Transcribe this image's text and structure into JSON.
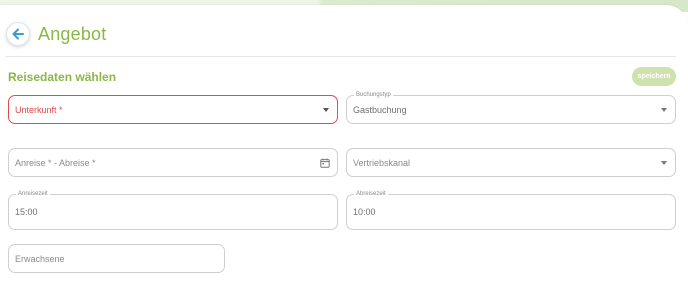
{
  "header": {
    "title": "Angebot",
    "back_icon": "arrow-left-icon"
  },
  "section": {
    "title": "Reisedaten wählen",
    "save_label": "speichern"
  },
  "fields": {
    "unterkunft": {
      "placeholder": "Unterkunft *"
    },
    "buchungstyp": {
      "label": "Buchungstyp",
      "value": "Gastbuchung"
    },
    "anreise_abreise": {
      "placeholder": "Anreise * - Abreise *"
    },
    "vertriebskanal": {
      "placeholder": "Vertriebskanal"
    },
    "anreisezeit": {
      "label": "Anreisezeit",
      "value": "15:00"
    },
    "abreisezeit": {
      "label": "Abreisezeit",
      "value": "10:00"
    },
    "erwachsene": {
      "placeholder": "Erwachsene"
    }
  },
  "colors": {
    "accent": "#8ab843",
    "error": "#e34a4a",
    "back_icon": "#3a9ad9",
    "save_button_bg": "#cfe2ae"
  }
}
